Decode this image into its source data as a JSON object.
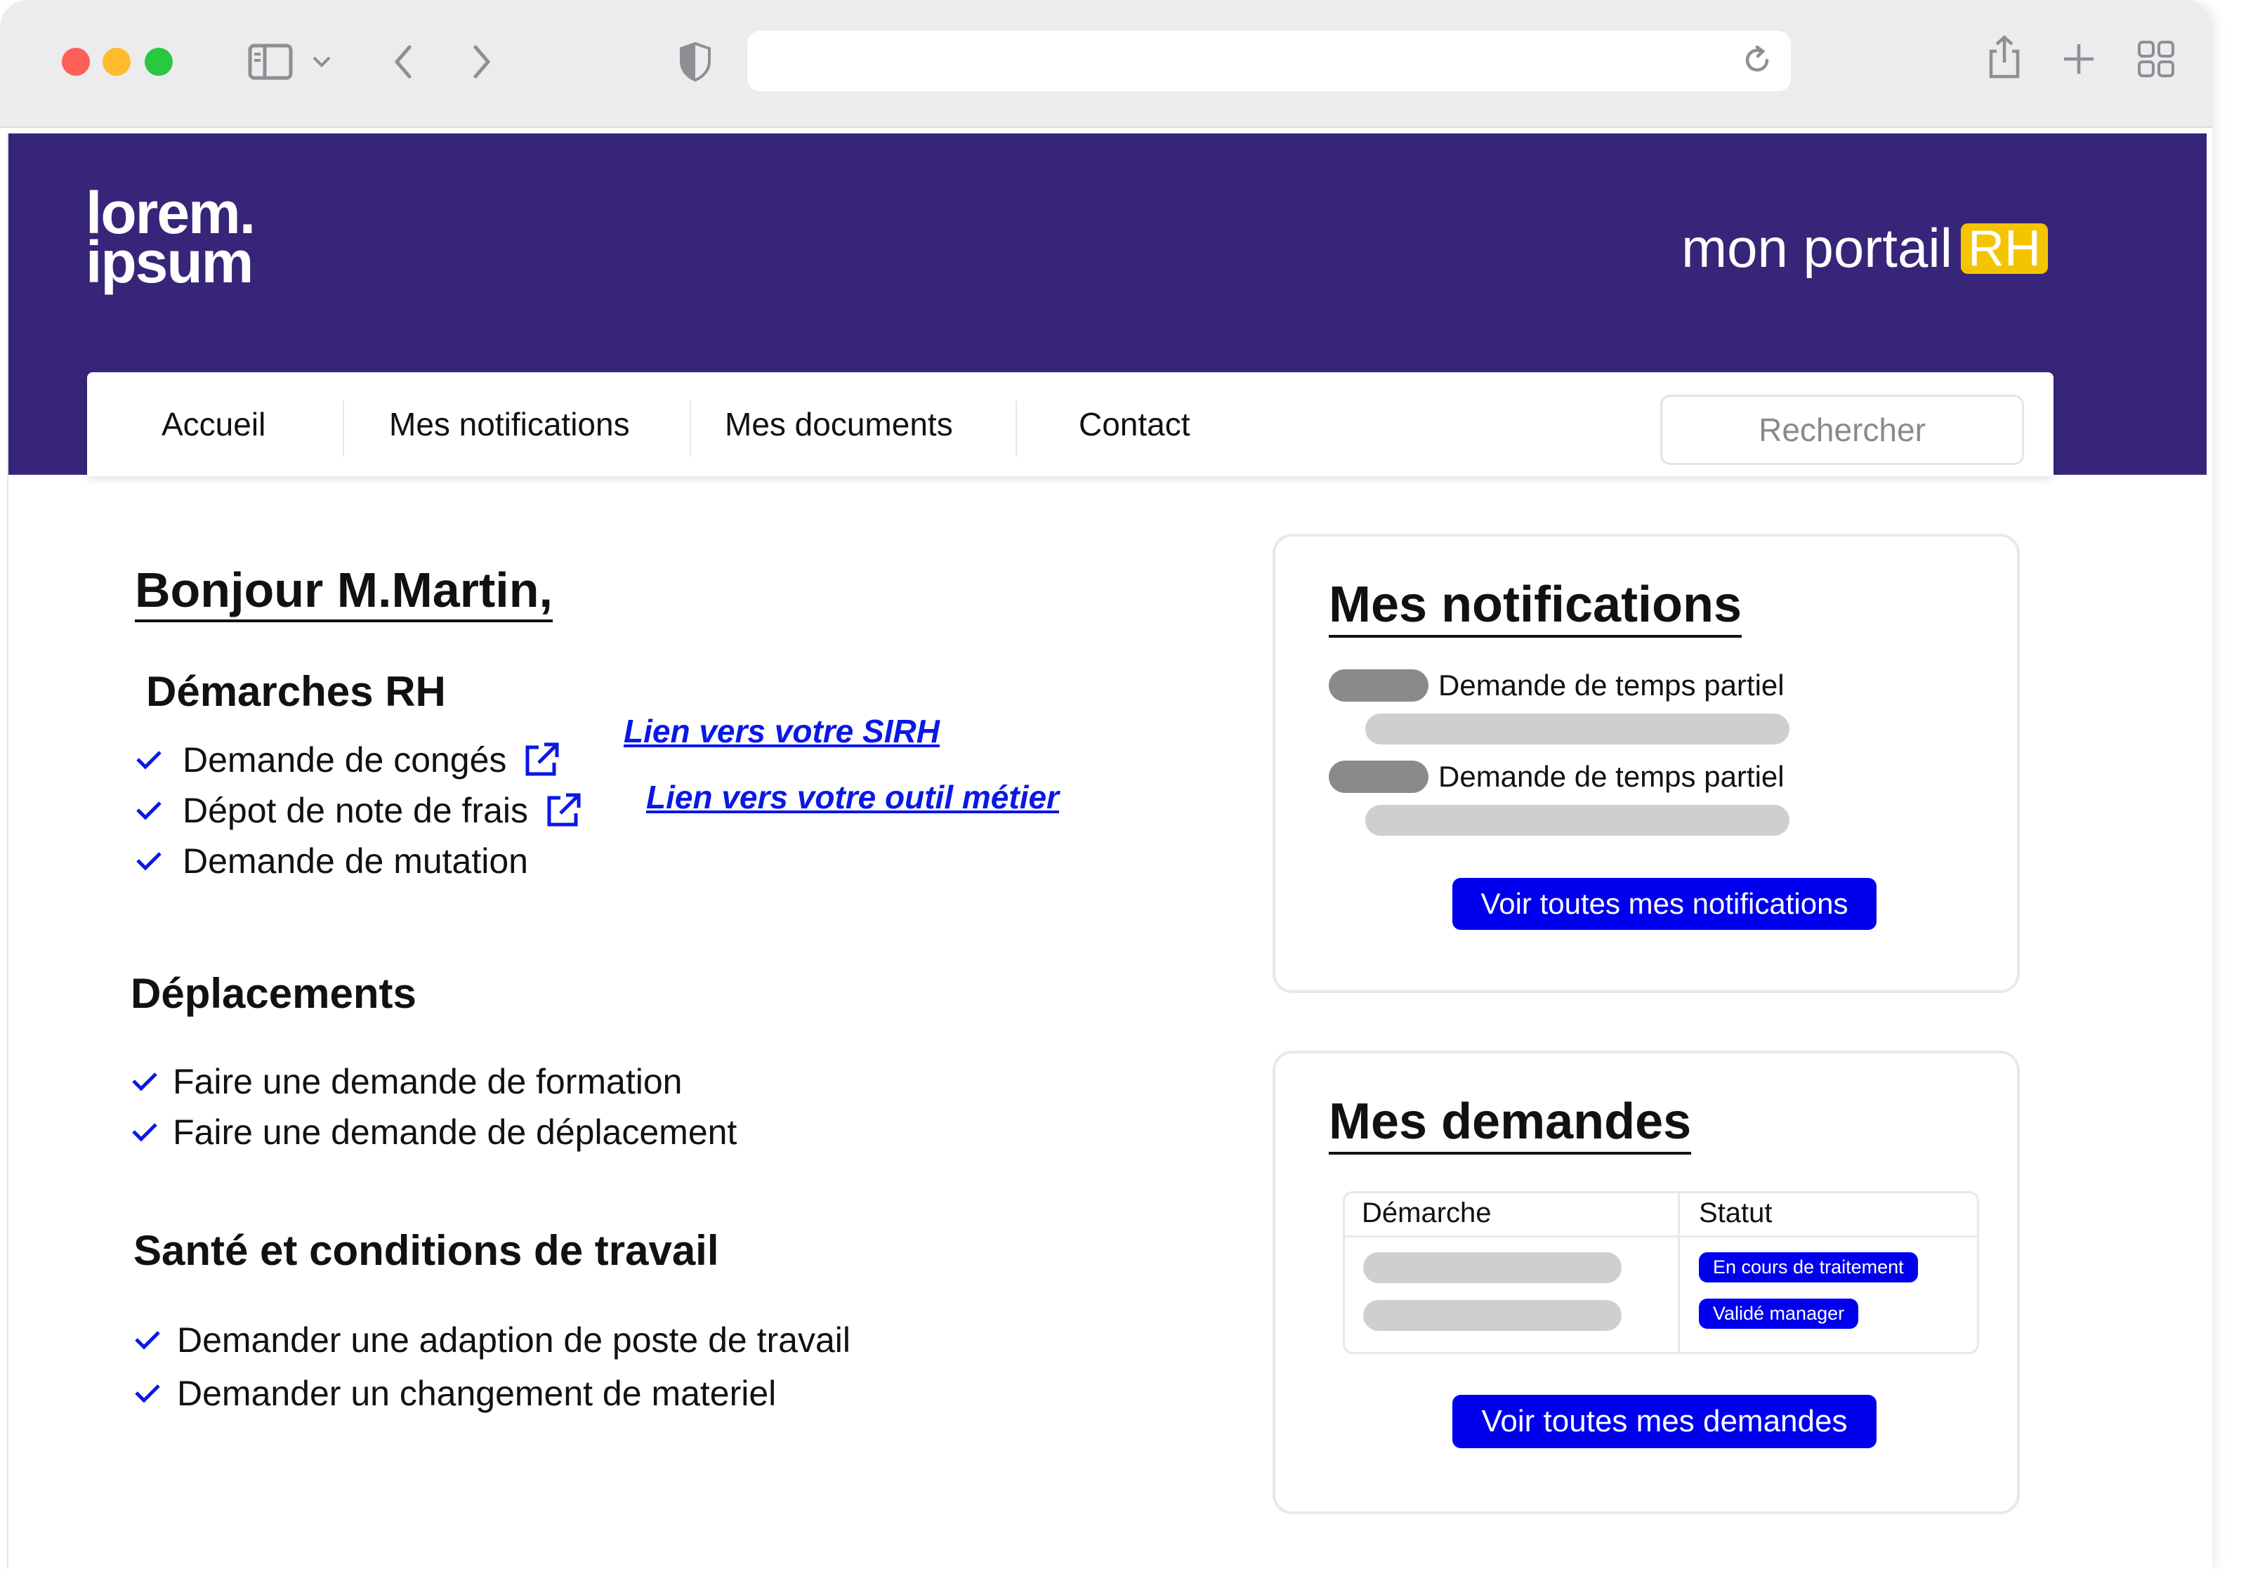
{
  "browser": {
    "address": "",
    "icons": [
      "sidebar-icon",
      "chevron-down-icon",
      "back-icon",
      "forward-icon",
      "shield-icon",
      "reload-icon",
      "share-icon",
      "new-tab-icon",
      "tabs-overview-icon"
    ]
  },
  "header": {
    "logo_line1": "lorem.",
    "logo_line2": "ipsum",
    "portal_text": "mon portail",
    "portal_badge": "RH",
    "brand_color": "#372579",
    "badge_color": "#f5c400"
  },
  "nav": {
    "items": [
      "Accueil",
      "Mes notifications",
      "Mes documents",
      "Contact"
    ],
    "search_placeholder": "Rechercher"
  },
  "main": {
    "greeting": "Bonjour M.Martin,",
    "sections": [
      {
        "title": "Démarches RH",
        "items": [
          "Demande de congés",
          "Dépot de note de frais",
          "Demande de mutation"
        ]
      },
      {
        "title": "Déplacements",
        "items": [
          "Faire une demande de formation",
          "Faire une demande de déplacement"
        ]
      },
      {
        "title": "Santé et conditions de travail",
        "items": [
          "Demander une adaption de poste de travail",
          "Demander un changement de materiel"
        ]
      }
    ],
    "links": {
      "sirh": "Lien vers votre SIRH",
      "outil": "Lien vers votre outil métier"
    }
  },
  "notifications": {
    "title": "Mes notifications",
    "items": [
      "Demande de temps partiel",
      "Demande de temps partiel"
    ],
    "button": "Voir toutes mes notifications"
  },
  "demandes": {
    "title": "Mes demandes",
    "columns": [
      "Démarche",
      "Statut"
    ],
    "statuses": [
      "En cours de traitement",
      "Validé manager"
    ],
    "button": "Voir toutes mes demandes",
    "accent_color": "#0000ee"
  }
}
